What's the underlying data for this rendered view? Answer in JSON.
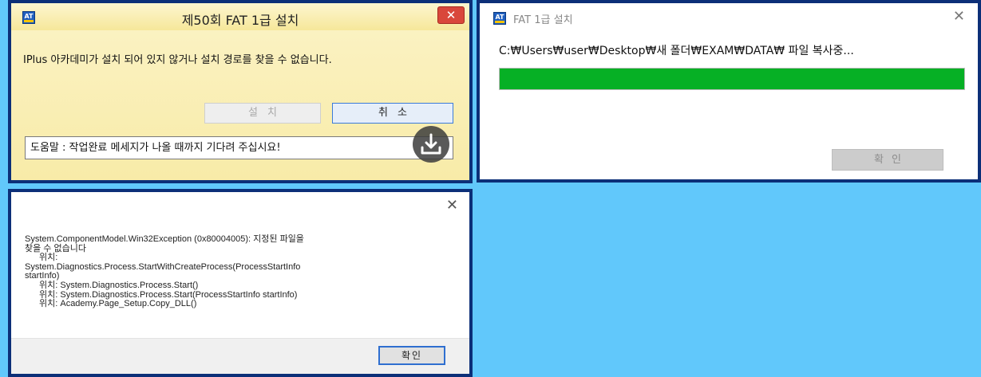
{
  "install_dialog": {
    "title": "제50회 FAT 1급 설치",
    "logo_text": "AT",
    "close_label": "✕",
    "message": "IPlus 아카데미가 설치 되어 있지 않거나 설치 경로를 찾을 수  없습니다.",
    "install_label": "설치",
    "cancel_label": "취소",
    "help_text": "도움말 : 작업완료 메세지가 나올 때까지 기다려 주십시요!",
    "download_icon": "download-tray-icon"
  },
  "progress_dialog": {
    "title": "FAT 1급 설치",
    "logo_text": "AT",
    "close_label": "✕",
    "copy_status": "C:₩Users₩user₩Desktop₩새 폴더₩EXAM₩DATA₩ 파일 복사중...",
    "progress_fraction": 1.0,
    "progress_color": "#06b025",
    "confirm_label": "확인"
  },
  "error_dialog": {
    "close_label": "✕",
    "lines": [
      "System.ComponentModel.Win32Exception (0x80004005): 지정된 파일을",
      "찾을 수 없습니다",
      "위치:",
      "System.Diagnostics.Process.StartWithCreateProcess(ProcessStartInfo",
      "startInfo)",
      "위치: System.Diagnostics.Process.Start()",
      "위치: System.Diagnostics.Process.Start(ProcessStartInfo startInfo)",
      "위치: Academy.Page_Setup.Copy_DLL()"
    ],
    "confirm_label": "확인"
  },
  "colors": {
    "background": "#61c8fb",
    "panel_border": "#0c2f78",
    "progress_green": "#06b025",
    "close_red": "#d9473b"
  }
}
